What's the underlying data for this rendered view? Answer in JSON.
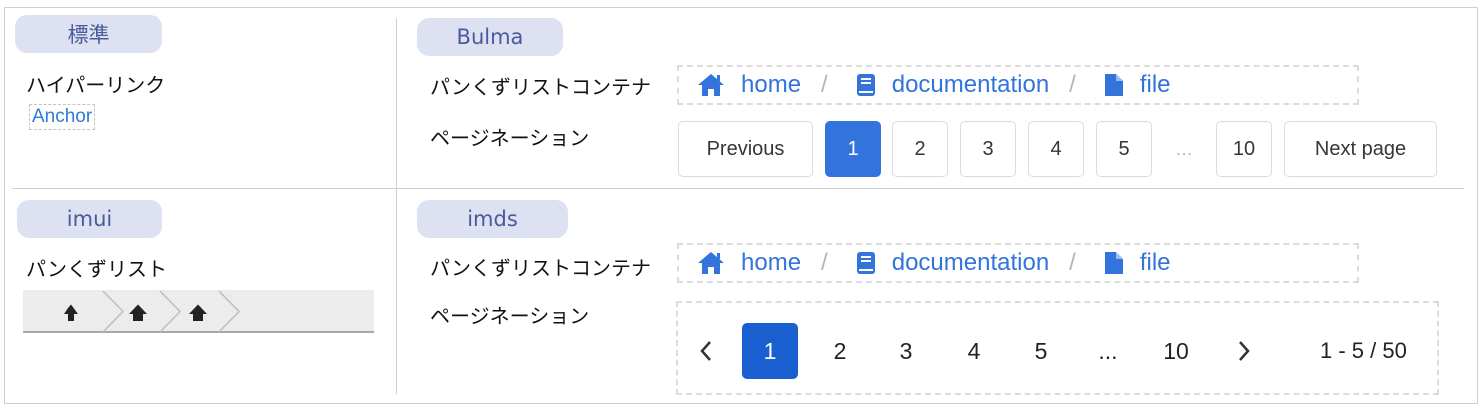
{
  "standard": {
    "tag": "標準",
    "hyperlink_label": "ハイパーリンク",
    "anchor_text": "Anchor"
  },
  "imui": {
    "tag": "imui",
    "breadcrumb_label": "パンくずリスト",
    "breadcrumb_items": [
      "home-icon",
      "home-icon",
      "home-icon"
    ]
  },
  "bulma": {
    "tag": "Bulma",
    "breadcrumb_label": "パンくずリストコンテナ",
    "pagination_label": "ページネーション",
    "breadcrumb": [
      {
        "icon": "home-icon",
        "label": "home"
      },
      {
        "icon": "book-icon",
        "label": "documentation"
      },
      {
        "icon": "file-icon",
        "label": "file"
      }
    ],
    "separator": "/",
    "pagination": {
      "previous": "Previous",
      "next": "Next page",
      "pages": [
        "1",
        "2",
        "3",
        "4",
        "5"
      ],
      "ellipsis": "…",
      "last": "10",
      "current": "1"
    }
  },
  "imds": {
    "tag": "imds",
    "breadcrumb_label": "パンくずリストコンテナ",
    "pagination_label": "ページネーション",
    "breadcrumb": [
      {
        "icon": "home-icon",
        "label": "home"
      },
      {
        "icon": "book-icon",
        "label": "documentation"
      },
      {
        "icon": "file-icon",
        "label": "file"
      }
    ],
    "separator": "/",
    "pagination": {
      "prev_icon": "chevron-left-icon",
      "next_icon": "chevron-right-icon",
      "pages": [
        "1",
        "2",
        "3",
        "4",
        "5"
      ],
      "ellipsis": "...",
      "last": "10",
      "current": "1",
      "range": "1 - 5 / 50"
    }
  },
  "colors": {
    "tag_bg": "#dde1f2",
    "tag_text": "#4b5a9b",
    "link": "#3273dc",
    "bulma_current": "#3273dc",
    "imds_current": "#1a5fd0"
  }
}
